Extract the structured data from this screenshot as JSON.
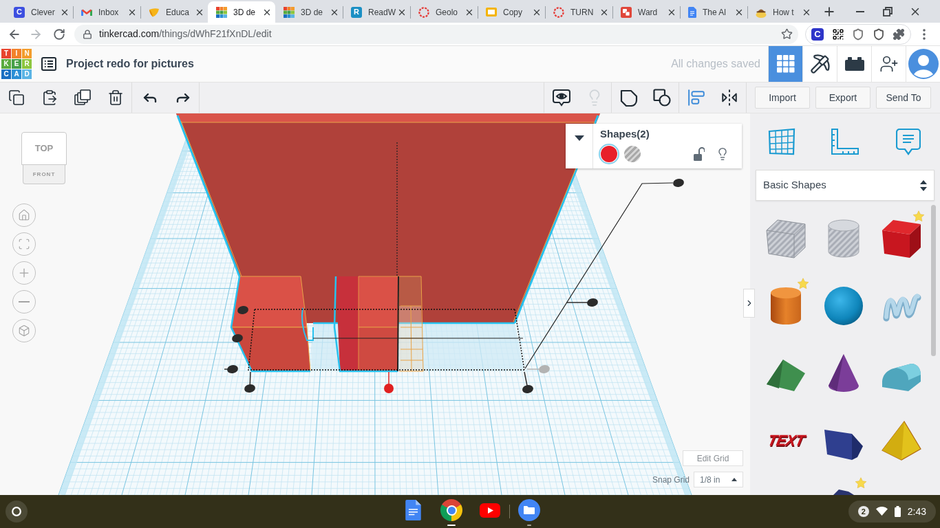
{
  "browser": {
    "tabs": [
      {
        "kind": "letter",
        "letter": "C",
        "color": "#3d4fe0",
        "title": "Clever",
        "selected": false
      },
      {
        "kind": "envelope",
        "title": "Inbox",
        "selected": false
      },
      {
        "kind": "leaf",
        "title": "Educa",
        "selected": false
      },
      {
        "kind": "tiles",
        "title": "3D de",
        "selected": true
      },
      {
        "kind": "tiles",
        "title": "3D de",
        "selected": false
      },
      {
        "kind": "letter",
        "letter": "R",
        "color": "#1a8fc4",
        "title": "ReadW",
        "selected": false
      },
      {
        "kind": "ring",
        "title": "Geolo",
        "selected": false
      },
      {
        "kind": "slides",
        "title": "Copy",
        "selected": false
      },
      {
        "kind": "ring",
        "title": "TURN",
        "selected": false
      },
      {
        "kind": "squares",
        "title": "Ward",
        "selected": false
      },
      {
        "kind": "document",
        "title": "The Al",
        "selected": false
      },
      {
        "kind": "cartoon",
        "title": "How t",
        "selected": false
      }
    ],
    "address": {
      "host": "tinkercad.com",
      "path": "/things/dWhF21fXnDL/edit"
    },
    "extension_letter": "C"
  },
  "app": {
    "logo": [
      {
        "letter": "T",
        "color": "#e8432d"
      },
      {
        "letter": "I",
        "color": "#f2812b"
      },
      {
        "letter": "N",
        "color": "#f39c2b"
      },
      {
        "letter": "K",
        "color": "#5aab3f"
      },
      {
        "letter": "E",
        "color": "#45a047"
      },
      {
        "letter": "R",
        "color": "#8cc63e"
      },
      {
        "letter": "C",
        "color": "#1a6fc2"
      },
      {
        "letter": "A",
        "color": "#2b8fd6"
      },
      {
        "letter": "D",
        "color": "#5ab4e5"
      }
    ],
    "project_title": "Project redo for pictures",
    "save_status": "All changes saved",
    "views": [
      {
        "selected": true
      },
      {
        "selected": false
      },
      {
        "selected": false
      }
    ]
  },
  "toolbar": {
    "right_tools": [
      {
        "disabled": false
      },
      {
        "disabled": true
      },
      {
        "disabled": false
      },
      {
        "disabled": false
      },
      {
        "disabled": false
      },
      {
        "disabled": false
      }
    ],
    "buttons": [
      "Import",
      "Export",
      "Send To"
    ]
  },
  "view_cube": {
    "top": "TOP",
    "front": "FRONT"
  },
  "inspector": {
    "title": "Shapes(2)",
    "colors": [
      {
        "kind": "solid",
        "color": "#e8202a",
        "selected": true
      },
      {
        "kind": "hole",
        "selected": false
      }
    ],
    "locked": false
  },
  "grid_controls": {
    "edit_grid": "Edit Grid",
    "snap_label": "Snap Grid",
    "snap_value": "1/8 in"
  },
  "sidebar": {
    "category": "Basic Shapes",
    "shapes": [
      {
        "kind": "boxhole",
        "starred": false
      },
      {
        "kind": "cylinderhole",
        "starred": false
      },
      {
        "kind": "box",
        "starred": true
      },
      {
        "kind": "cylinder",
        "starred": true
      },
      {
        "kind": "sphere",
        "starred": false
      },
      {
        "kind": "scribble",
        "starred": false
      },
      {
        "kind": "roof",
        "starred": false
      },
      {
        "kind": "cone",
        "starred": false
      },
      {
        "kind": "roundroof",
        "starred": false
      },
      {
        "kind": "text",
        "label": "TEXT",
        "starred": false
      },
      {
        "kind": "polygon",
        "starred": false
      },
      {
        "kind": "pyramid",
        "starred": false
      },
      {
        "kind": "partial",
        "starred": true
      }
    ]
  },
  "taskbar": {
    "apps": [
      {
        "running": false,
        "focused": false
      },
      {
        "running": true,
        "focused": true
      },
      {
        "running": false,
        "focused": false
      },
      {
        "running": true,
        "focused": false
      }
    ],
    "notifications": "2",
    "time": "2:43"
  }
}
